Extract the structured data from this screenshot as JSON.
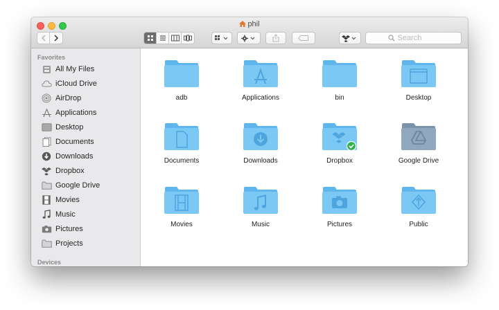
{
  "window": {
    "title": "phil"
  },
  "toolbar": {
    "search_placeholder": "Search"
  },
  "sidebar": {
    "favorites_label": "Favorites",
    "devices_label": "Devices",
    "items": [
      {
        "label": "All My Files",
        "icon": "all-files-icon"
      },
      {
        "label": "iCloud Drive",
        "icon": "cloud-icon"
      },
      {
        "label": "AirDrop",
        "icon": "airdrop-icon"
      },
      {
        "label": "Applications",
        "icon": "applications-icon"
      },
      {
        "label": "Desktop",
        "icon": "desktop-icon"
      },
      {
        "label": "Documents",
        "icon": "documents-icon"
      },
      {
        "label": "Downloads",
        "icon": "downloads-icon"
      },
      {
        "label": "Dropbox",
        "icon": "dropbox-icon"
      },
      {
        "label": "Google Drive",
        "icon": "folder-icon"
      },
      {
        "label": "Movies",
        "icon": "movies-icon"
      },
      {
        "label": "Music",
        "icon": "music-icon"
      },
      {
        "label": "Pictures",
        "icon": "pictures-icon"
      },
      {
        "label": "Projects",
        "icon": "folder-icon"
      }
    ]
  },
  "files": [
    {
      "name": "adb",
      "icon": "folder-icon"
    },
    {
      "name": "Applications",
      "icon": "applications-folder-icon"
    },
    {
      "name": "bin",
      "icon": "folder-icon"
    },
    {
      "name": "Desktop",
      "icon": "desktop-folder-icon"
    },
    {
      "name": "Documents",
      "icon": "documents-folder-icon"
    },
    {
      "name": "Downloads",
      "icon": "downloads-folder-icon"
    },
    {
      "name": "Dropbox",
      "icon": "dropbox-folder-icon"
    },
    {
      "name": "Google Drive",
      "icon": "google-drive-folder-icon"
    },
    {
      "name": "Movies",
      "icon": "movies-folder-icon"
    },
    {
      "name": "Music",
      "icon": "music-folder-icon"
    },
    {
      "name": "Pictures",
      "icon": "pictures-folder-icon"
    },
    {
      "name": "Public",
      "icon": "public-folder-icon"
    }
  ],
  "colors": {
    "folder_blue": "#7cc8f4",
    "folder_tab": "#5fb6ec",
    "folder_glyph": "#4ea4dd",
    "google_drive_folder": "#8fa7bf",
    "sync_check": "#2fb24a"
  }
}
